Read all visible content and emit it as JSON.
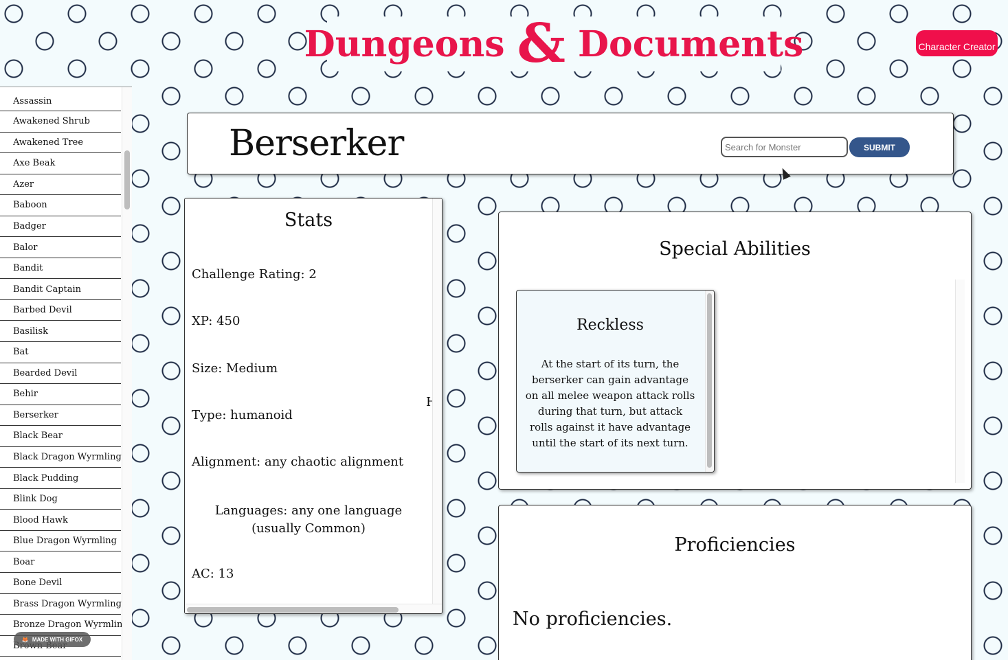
{
  "header": {
    "logo_left": "Dungeons",
    "logo_amp": "&",
    "logo_right": "Documents",
    "character_creator_label": "Character Creator",
    "accent_color": "#e8154b"
  },
  "sidebar": {
    "items": [
      "Assassin",
      "Awakened Shrub",
      "Awakened Tree",
      "Axe Beak",
      "Azer",
      "Baboon",
      "Badger",
      "Balor",
      "Bandit",
      "Bandit Captain",
      "Barbed Devil",
      "Basilisk",
      "Bat",
      "Bearded Devil",
      "Behir",
      "Berserker",
      "Black Bear",
      "Black Dragon Wyrmling",
      "Black Pudding",
      "Blink Dog",
      "Blood Hawk",
      "Blue Dragon Wyrmling",
      "Boar",
      "Bone Devil",
      "Brass Dragon Wyrmling",
      "Bronze Dragon Wyrmling",
      "Brown Bear"
    ]
  },
  "badge": {
    "label": "MADE WITH GIFOX"
  },
  "monster": {
    "name": "Berserker"
  },
  "search": {
    "placeholder": "Search for Monster",
    "submit_label": "SUBMIT"
  },
  "stats": {
    "title": "Stats",
    "challenge_rating": "Challenge Rating: 2",
    "xp": "XP: 450",
    "size": "Size: Medium",
    "type": "Type: humanoid",
    "alignment": "Alignment: any chaotic alignment",
    "languages": "Languages: any one language (usually Common)",
    "ac": "AC: 13",
    "clipped": "H"
  },
  "abilities": {
    "title": "Special Abilities",
    "items": [
      {
        "name": "Reckless",
        "desc": "At the start of its turn, the berserker can gain advantage on all melee weapon attack rolls during that turn, but attack rolls against it have advantage until the start of its next turn."
      }
    ]
  },
  "proficiencies": {
    "title": "Proficiencies",
    "empty_text": "No proficiencies."
  }
}
